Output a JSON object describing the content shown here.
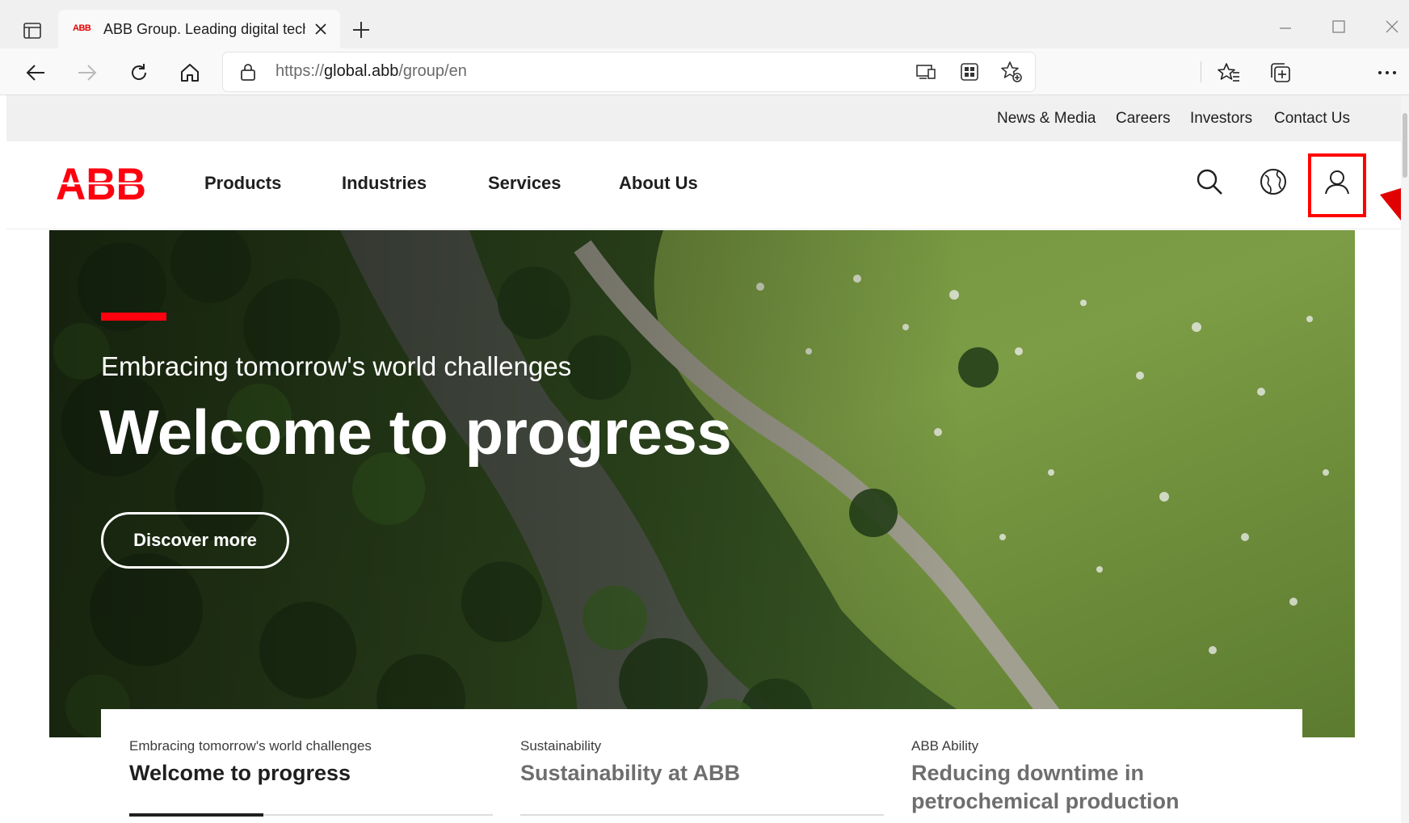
{
  "browser": {
    "tab": {
      "favicon_text": "ABB",
      "title": "ABB Group. Leading digital techr"
    },
    "address_bar": {
      "url_prefix": "https://",
      "url_host": "global.abb",
      "url_path": "/group/en"
    }
  },
  "utility_nav": {
    "links": [
      "News & Media",
      "Careers",
      "Investors",
      "Contact Us"
    ]
  },
  "main_nav": {
    "logo_text": "ABB",
    "items": [
      "Products",
      "Industries",
      "Services",
      "About Us"
    ]
  },
  "hero": {
    "kicker": "Embracing tomorrow's world challenges",
    "title": "Welcome to progress",
    "cta_label": "Discover more"
  },
  "cards": [
    {
      "eyebrow": "Embracing tomorrow's world challenges",
      "title": "Welcome to progress",
      "active": true
    },
    {
      "eyebrow": "Sustainability",
      "title": "Sustainability at ABB",
      "active": false
    },
    {
      "eyebrow": "ABB Ability",
      "title": "Reducing downtime in petrochemical production",
      "active": false
    }
  ],
  "colors": {
    "brand_red": "#ff000f",
    "highlight_red": "#ff0000",
    "text_dark": "#1f1f1f",
    "utility_bg": "#f0f0f0"
  },
  "icons": {
    "tab_actions": "tab-actions-icon",
    "back": "back-arrow-icon",
    "forward": "forward-arrow-icon",
    "refresh": "refresh-icon",
    "home": "home-icon",
    "lock": "lock-icon",
    "reader": "immersive-reader-icon",
    "apps": "apps-icon",
    "favorite_add": "add-favorite-icon",
    "favorites": "favorites-icon",
    "collections": "collections-icon",
    "more": "more-icon",
    "search": "search-icon",
    "globe": "globe-icon",
    "user": "user-icon"
  }
}
